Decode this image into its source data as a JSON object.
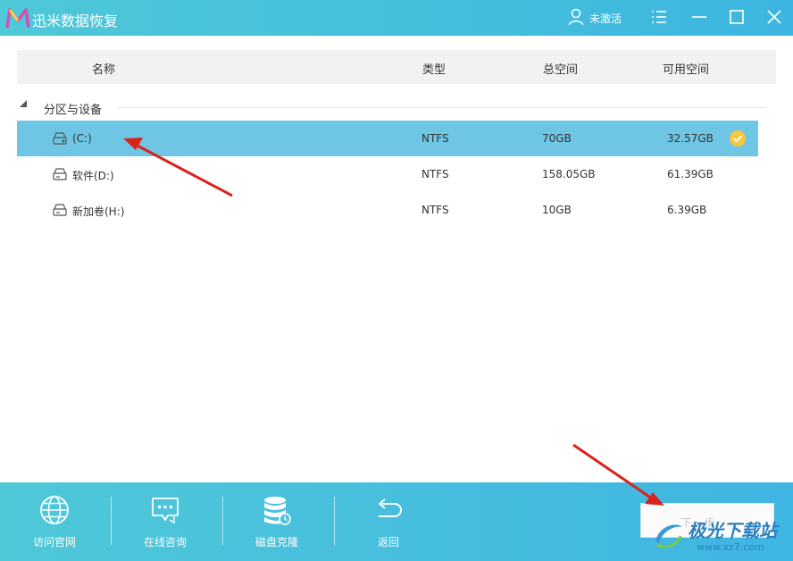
{
  "window": {
    "title": "迅米数据恢复",
    "user_label": "未激活"
  },
  "columns": {
    "name": "名称",
    "type": "类型",
    "total": "总空间",
    "free": "可用空间"
  },
  "group": {
    "label": "分区与设备"
  },
  "rows": [
    {
      "name": "(C:)",
      "type": "NTFS",
      "total": "70GB",
      "free": "32.57GB",
      "selected": true
    },
    {
      "name": "软件(D:)",
      "type": "NTFS",
      "total": "158.05GB",
      "free": "61.39GB",
      "selected": false
    },
    {
      "name": "新加卷(H:)",
      "type": "NTFS",
      "total": "10GB",
      "free": "6.39GB",
      "selected": false
    }
  ],
  "toolbar": {
    "visit_site": "访问官网",
    "online_chat": "在线咨询",
    "disk_clone": "磁盘克隆",
    "back": "返回",
    "next": "下一步"
  },
  "watermark": {
    "text": "极光下载站",
    "url": "www.xz7.com"
  },
  "colors": {
    "titlebar": "#4fc8d8",
    "selected_row": "#6ec6e4",
    "check": "#f5c842",
    "arrow": "#d9231d"
  },
  "icons": [
    "app-logo",
    "user-icon",
    "menu-icon",
    "minimize-icon",
    "maximize-icon",
    "close-icon",
    "triangle-down-icon",
    "drive-icon",
    "check-icon",
    "globe-icon",
    "chat-icon",
    "database-icon",
    "back-arrow-icon"
  ]
}
